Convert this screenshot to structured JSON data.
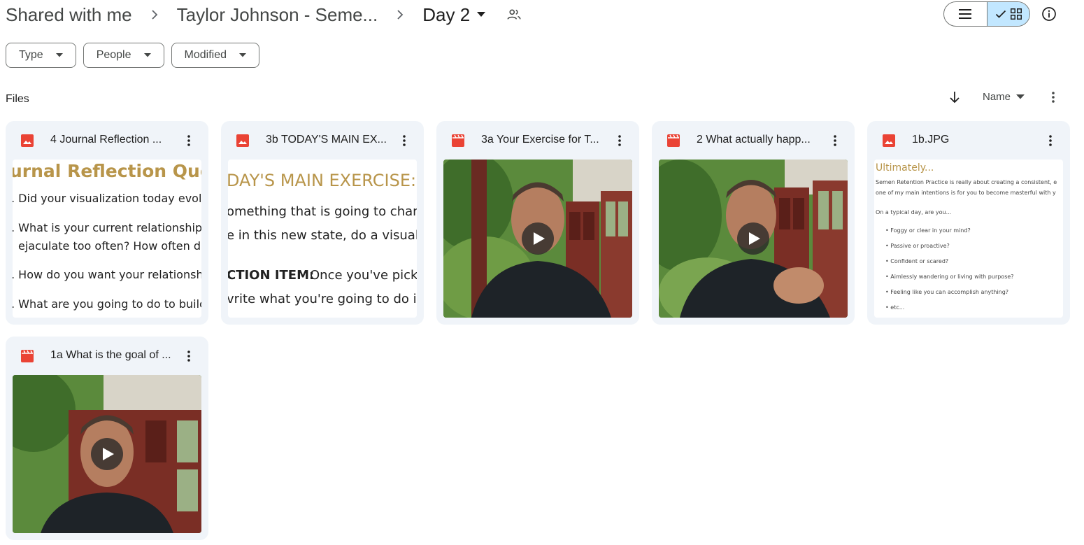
{
  "breadcrumb": {
    "root": "Shared with me",
    "parent": "Taylor Johnson - Seme...",
    "current": "Day 2"
  },
  "filters": {
    "type": "Type",
    "people": "People",
    "modified": "Modified"
  },
  "files_section": {
    "label": "Files",
    "sort_label": "Name"
  },
  "colors": {
    "image_icon": "#ea4335",
    "video_icon": "#ea4335",
    "toggle_active": "#c2e7ff",
    "card_bg": "#f0f4f9",
    "doc_heading": "#b8954a"
  },
  "files": [
    {
      "name": "4 Journal Reflection ...",
      "kind": "image",
      "icon": "image-file-icon",
      "preview_lines": [
        "urnal Reflection Quest",
        ". Did your visualization today evolv",
        ". What is your current relationship",
        "ejaculate too often? How often d",
        ". How do you want your relationsh",
        ". What are you going to do to builc"
      ]
    },
    {
      "name": "3b TODAY'S MAIN EX...",
      "kind": "image",
      "icon": "image-file-icon",
      "preview_lines": [
        "DAY'S MAIN EXERCISE:",
        "omething that is going to chang",
        "e in this new state, do a visualiz",
        "CTION ITEM:",
        " Once you've picke",
        "vrite what you're going to do in"
      ]
    },
    {
      "name": "3a Your Exercise for T...",
      "kind": "video",
      "icon": "video-file-icon"
    },
    {
      "name": "2 What actually happ...",
      "kind": "video",
      "icon": "video-file-icon"
    },
    {
      "name": "1b.JPG",
      "kind": "image",
      "icon": "image-file-icon",
      "preview_lines": [
        "Ultimately...",
        "Semen Retention Practice is really about creating a consistent, e",
        "one of my main intentions is for you to become masterful with y",
        "On a typical day, are you...",
        "Foggy or clear in your mind?",
        "Passive or proactive?",
        "Confident or scared?",
        "Aimlessly wandering or living with purpose?",
        "Feeling like you can accomplish anything?",
        "etc..."
      ]
    },
    {
      "name": "1a What is the goal of ...",
      "kind": "video",
      "icon": "video-file-icon"
    }
  ]
}
